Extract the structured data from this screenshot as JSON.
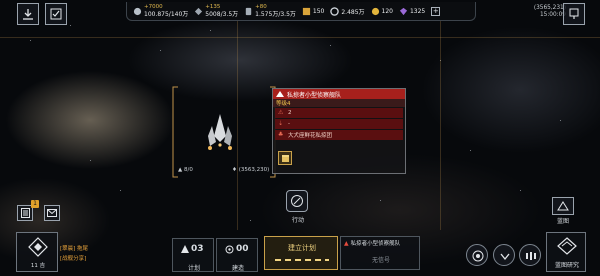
{
  "topbar": {
    "resources": [
      {
        "icon": "credits-icon",
        "increment": "+7000",
        "amount": "100.875/140万"
      },
      {
        "icon": "ore-icon",
        "increment": "+135",
        "amount": "5008/3.5万"
      },
      {
        "icon": "fuel-icon",
        "increment": "+80",
        "amount": "1.575万/3.5万"
      }
    ],
    "tokens": [
      {
        "icon": "gold-token-icon",
        "value": "150"
      },
      {
        "icon": "silver-coin-icon",
        "value": "2.485万"
      },
      {
        "icon": "yellow-coin-icon",
        "value": "120"
      },
      {
        "icon": "purple-gem-icon",
        "value": "1325"
      }
    ],
    "coordinates": "(3565,231)",
    "time": "15:00:09",
    "add_label": "+"
  },
  "map": {
    "fleet_label": "8/0",
    "coordinate_label": "(3563,230)",
    "action_label": "行动"
  },
  "info_panel": {
    "title": "私掠者小型侦察舰队",
    "level": "等级4",
    "rows": [
      {
        "icon": "warning-icon",
        "text": "2"
      },
      {
        "icon": "down-arrow-icon",
        "text": "-"
      },
      {
        "icon": "faction-icon",
        "text": "大犬座鲜花私掠团"
      }
    ],
    "colors": {
      "header": "#a7201c",
      "row": "#5a0f10",
      "level": "#f0c34a"
    }
  },
  "sidebar": {
    "mail_badge": "1",
    "blueprint_label": "蓝图"
  },
  "bottom": {
    "base_level": "11 吉",
    "fleet_name": "[翠晨] 拖尾",
    "fleet_sub": "[战舰分享]",
    "plan_count": "03",
    "plan_label": "计划",
    "build_count": "00",
    "build_label": "建造",
    "create_plan": "建立计划",
    "target_name": "私掠者小型侦察舰队",
    "target_status": "无信号",
    "research_label": "蓝图研究"
  }
}
